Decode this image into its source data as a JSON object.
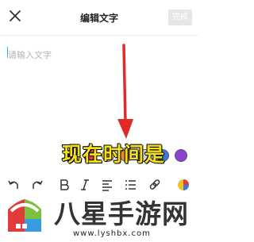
{
  "header": {
    "title": "编辑文字",
    "done_label": "完成"
  },
  "editor": {
    "placeholder": "请输入文字"
  },
  "overlay": {
    "caption": "现在时间是"
  },
  "palette": {
    "colors": [
      "#1b1b1b",
      "#e23b3b",
      "#f2c12e",
      "#f08a24",
      "#d8d8d8",
      "#3a7be0",
      "#8e3fd6",
      "#2a2a2a"
    ]
  },
  "toolbar": {
    "tools": [
      "undo-icon",
      "redo-icon",
      "bold-icon",
      "italic-icon",
      "align-icon",
      "list-icon",
      "link-icon",
      "color-icon"
    ]
  },
  "watermark": {
    "brand": "八星手游网",
    "url": "www.lyshbx.com"
  },
  "colors": {
    "accent_red": "#e02a2a",
    "caption_yellow": "#f4e019",
    "cursor_blue": "#3fa7ff"
  }
}
